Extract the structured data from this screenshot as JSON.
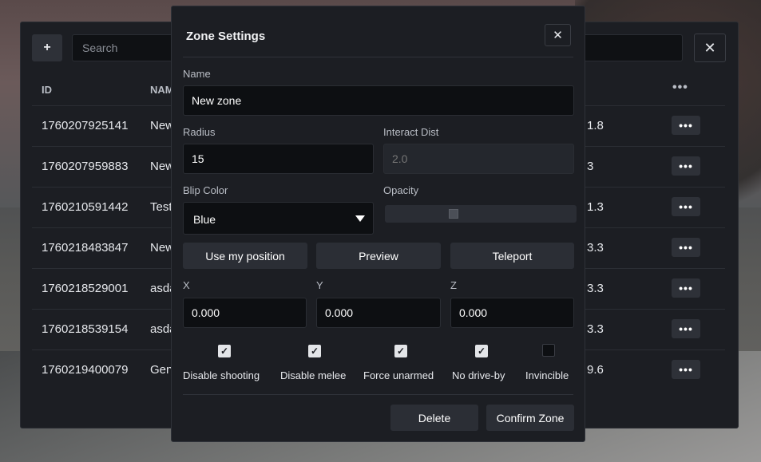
{
  "list": {
    "add_label": "+",
    "search_placeholder": "Search",
    "close_label": "✕",
    "columns": {
      "id": "ID",
      "name": "NAM",
      "more": "•••"
    },
    "rows": [
      {
        "id": "1760207925141",
        "name": "New",
        "dist": "1.8"
      },
      {
        "id": "1760207959883",
        "name": "New",
        "dist": "3"
      },
      {
        "id": "1760210591442",
        "name": "Test",
        "dist": "1.3"
      },
      {
        "id": "1760218483847",
        "name": "New",
        "dist": "3.3"
      },
      {
        "id": "1760218529001",
        "name": "asda",
        "dist": "3.3"
      },
      {
        "id": "1760218539154",
        "name": "asda",
        "dist": "3.3"
      },
      {
        "id": "1760219400079",
        "name": "Gen",
        "dist": "9.6"
      }
    ],
    "row_menu_label": "•••"
  },
  "modal": {
    "title": "Zone Settings",
    "close_label": "✕",
    "name_label": "Name",
    "name_value": "New zone",
    "radius_label": "Radius",
    "radius_value": "15",
    "interact_label": "Interact Dist",
    "interact_placeholder": "2.0",
    "blip_label": "Blip Color",
    "blip_value": "Blue",
    "opacity_label": "Opacity",
    "opacity_fraction": 0.35,
    "buttons": {
      "use_position": "Use my position",
      "preview": "Preview",
      "teleport": "Teleport"
    },
    "x_label": "X",
    "x_value": "0.000",
    "y_label": "Y",
    "y_value": "0.000",
    "z_label": "Z",
    "z_value": "0.000",
    "toggles": [
      {
        "label": "Disable shooting",
        "checked": true
      },
      {
        "label": "Disable melee",
        "checked": true
      },
      {
        "label": "Force unarmed",
        "checked": true
      },
      {
        "label": "No drive-by",
        "checked": true
      },
      {
        "label": "Invincible",
        "checked": false
      }
    ],
    "check_mark": "✓",
    "delete_label": "Delete",
    "confirm_label": "Confirm Zone"
  }
}
